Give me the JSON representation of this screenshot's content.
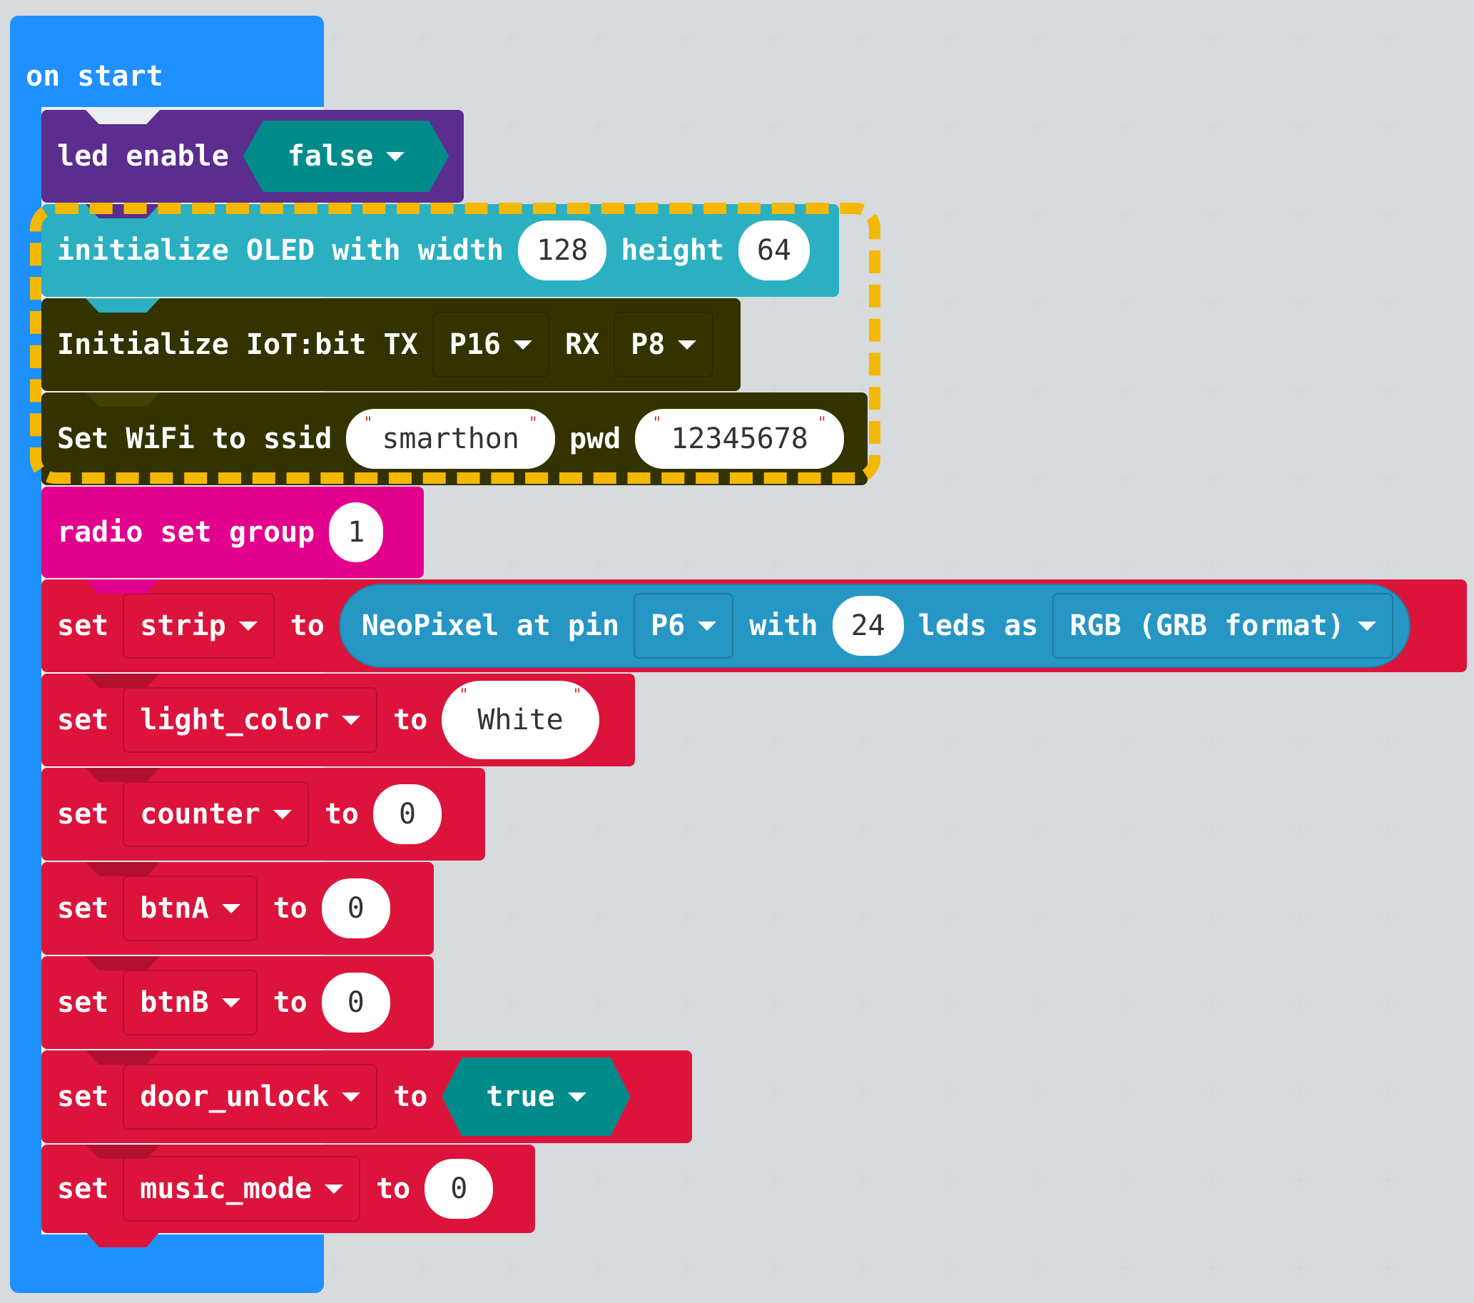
{
  "hat": {
    "label": "on start"
  },
  "led": {
    "prefix": "led enable",
    "value": "false"
  },
  "oled": {
    "prefix": "initialize OLED with width",
    "width": "128",
    "mid": "height",
    "height": "64"
  },
  "iot": {
    "prefix": "Initialize IoT:bit TX",
    "tx": "P16",
    "mid": "RX",
    "rx": "P8"
  },
  "wifi": {
    "prefix": "Set WiFi to ssid",
    "ssid": "smarthon",
    "mid": "pwd",
    "pwd": "12345678"
  },
  "radio": {
    "prefix": "radio set group",
    "value": "1"
  },
  "neopixel": {
    "set": "set",
    "var": "strip",
    "to": "to",
    "a": "NeoPixel at pin",
    "pin": "P6",
    "b": "with",
    "count": "24",
    "c": "leds as",
    "mode": "RGB (GRB format)"
  },
  "sets": [
    {
      "set": "set",
      "var": "light_color",
      "to": "to",
      "value": "White"
    },
    {
      "set": "set",
      "var": "counter",
      "to": "to",
      "value": "0"
    },
    {
      "set": "set",
      "var": "btnA",
      "to": "to",
      "value": "0"
    },
    {
      "set": "set",
      "var": "btnB",
      "to": "to",
      "value": "0"
    },
    {
      "set": "set",
      "var": "door_unlock",
      "to": "to",
      "value": "true"
    },
    {
      "set": "set",
      "var": "music_mode",
      "to": "to",
      "value": "0"
    }
  ],
  "colors": {
    "hat": "#1e90ff",
    "led": "#5b2d8f",
    "oled": "#2ab0c0",
    "iot": "#333300",
    "radio": "#e3008c",
    "vars": "#dc143c",
    "logic": "#008b8b",
    "neopixel": "#2696c4",
    "highlight": "#f5b800"
  }
}
